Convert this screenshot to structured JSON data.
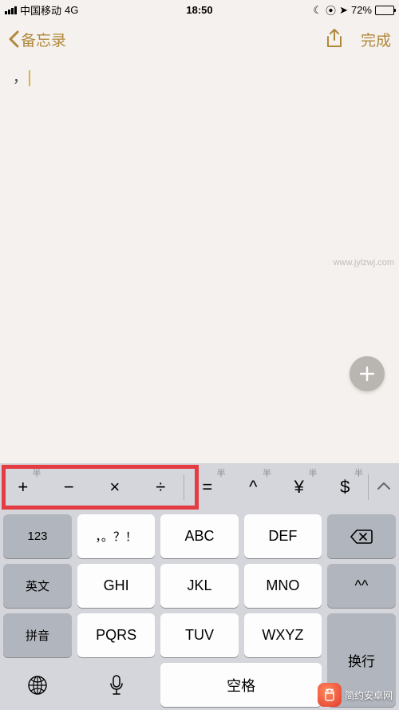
{
  "status": {
    "carrier": "中国移动",
    "network": "4G",
    "time": "18:50",
    "battery_pct": "72%"
  },
  "nav": {
    "back_label": "备忘录",
    "done_label": "完成"
  },
  "note": {
    "content": "，"
  },
  "predictions": {
    "items": [
      "+",
      "−",
      "×",
      "÷",
      "=",
      "^",
      "¥",
      "$"
    ],
    "tag": "半"
  },
  "keyboard": {
    "row1": {
      "k1": "123",
      "k2": "，。？！",
      "k3": "ABC",
      "k4": "DEF"
    },
    "row2": {
      "k1": "英文",
      "k2": "GHI",
      "k3": "JKL",
      "k4": "MNO",
      "k5": "^^"
    },
    "row3": {
      "k1": "拼音",
      "k2": "PQRS",
      "k3": "TUV",
      "k4": "WXYZ"
    },
    "row4": {
      "space": "空格",
      "return": "换行"
    }
  },
  "watermark": {
    "side": "www.jylzwj.com",
    "brand": "简约安卓网"
  }
}
